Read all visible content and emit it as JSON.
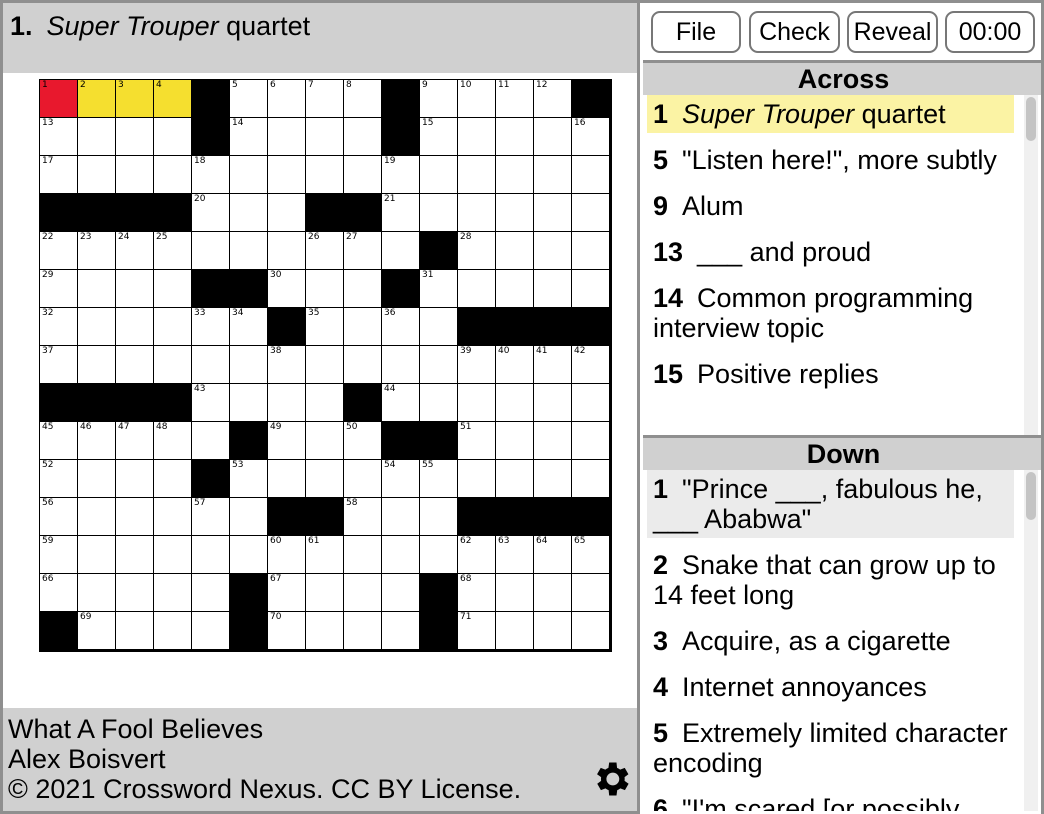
{
  "current_clue": {
    "number": "1.",
    "text_italic": "Super Trouper",
    "text_rest": " quartet"
  },
  "toolbar": {
    "file_label": "File",
    "check_label": "Check",
    "reveal_label": "Reveal",
    "timer": "00:00"
  },
  "across_title": "Across",
  "down_title": "Down",
  "across_clues": [
    {
      "num": "1",
      "italic": "Super Trouper",
      "text": " quartet"
    },
    {
      "num": "5",
      "italic": "",
      "text": "\"Listen here!\", more subtly"
    },
    {
      "num": "9",
      "italic": "",
      "text": "Alum"
    },
    {
      "num": "13",
      "italic": "",
      "text": "___ and proud"
    },
    {
      "num": "14",
      "italic": "",
      "text": "Common programming interview topic"
    },
    {
      "num": "15",
      "italic": "",
      "text": "Positive replies"
    }
  ],
  "down_clues": [
    {
      "num": "1",
      "text": "\"Prince ___, fabulous he, ___ Ababwa\""
    },
    {
      "num": "2",
      "text": "Snake that can grow up to 14 feet long"
    },
    {
      "num": "3",
      "text": "Acquire, as a cigarette"
    },
    {
      "num": "4",
      "text": "Internet annoyances"
    },
    {
      "num": "5",
      "text": "Extremely limited character encoding"
    },
    {
      "num": "6",
      "text": "\"I'm scared [or possibly"
    }
  ],
  "footer": {
    "title": "What A Fool Believes",
    "author": "Alex Boisvert",
    "copyright": "© 2021 Crossword Nexus. CC BY License."
  },
  "grid": {
    "rows": [
      "....#....#....#",
      "....#....#.....",
      "...............",
      "#####...##.....",
      "..........#....",
      "....##...#.....",
      "......#....####",
      "...............",
      "#####....#.....",
      "......#...##...",
      ".....#.........",
      ".....#..##...##",
      "...............",
      "......#....#...",
      "#.....#....#..."
    ],
    "rows_fixed": [
      "....#....#...#",
      "....#....#....",
      ".............."
    ],
    "numbers": [
      [
        0,
        0,
        "1"
      ],
      [
        0,
        1,
        "2"
      ],
      [
        0,
        2,
        "3"
      ],
      [
        0,
        3,
        "4"
      ],
      [
        0,
        5,
        "5"
      ],
      [
        0,
        6,
        "6"
      ],
      [
        0,
        7,
        "7"
      ],
      [
        0,
        8,
        "8"
      ],
      [
        0,
        10,
        "9"
      ],
      [
        0,
        11,
        "10"
      ],
      [
        0,
        12,
        "11"
      ],
      [
        0,
        13,
        "12"
      ],
      [
        1,
        0,
        "13"
      ],
      [
        1,
        5,
        "14"
      ],
      [
        1,
        10,
        "15"
      ],
      [
        1,
        14,
        "16"
      ],
      [
        2,
        0,
        "17"
      ],
      [
        2,
        4,
        "18"
      ],
      [
        2,
        9,
        "19"
      ],
      [
        3,
        4,
        "20"
      ],
      [
        3,
        9,
        "21"
      ],
      [
        4,
        0,
        "22"
      ],
      [
        4,
        1,
        "23"
      ],
      [
        4,
        2,
        "24"
      ],
      [
        4,
        3,
        "25"
      ],
      [
        4,
        7,
        "26"
      ],
      [
        4,
        8,
        "27"
      ],
      [
        4,
        11,
        "28"
      ],
      [
        5,
        0,
        "29"
      ],
      [
        5,
        6,
        "30"
      ],
      [
        5,
        10,
        "31"
      ],
      [
        6,
        0,
        "32"
      ],
      [
        6,
        4,
        "33"
      ],
      [
        6,
        5,
        "34"
      ],
      [
        6,
        7,
        "35"
      ],
      [
        6,
        9,
        "36"
      ],
      [
        7,
        0,
        "37"
      ],
      [
        7,
        6,
        "38"
      ],
      [
        7,
        11,
        "39"
      ],
      [
        7,
        12,
        "40"
      ],
      [
        7,
        13,
        "41"
      ],
      [
        7,
        14,
        "42"
      ],
      [
        8,
        4,
        "43"
      ],
      [
        8,
        9,
        "44"
      ],
      [
        9,
        0,
        "45"
      ],
      [
        9,
        1,
        "46"
      ],
      [
        9,
        2,
        "47"
      ],
      [
        9,
        3,
        "48"
      ],
      [
        9,
        6,
        "49"
      ],
      [
        9,
        8,
        "50"
      ],
      [
        9,
        11,
        "51"
      ],
      [
        10,
        0,
        "52"
      ],
      [
        10,
        5,
        "53"
      ],
      [
        10,
        9,
        "54"
      ],
      [
        10,
        10,
        "55"
      ],
      [
        11,
        0,
        "56"
      ],
      [
        11,
        4,
        "57"
      ],
      [
        11,
        8,
        "58"
      ],
      [
        12,
        0,
        "59"
      ],
      [
        12,
        6,
        "60"
      ],
      [
        12,
        7,
        "61"
      ],
      [
        12,
        11,
        "62"
      ],
      [
        12,
        12,
        "63"
      ],
      [
        12,
        13,
        "64"
      ],
      [
        12,
        14,
        "65"
      ],
      [
        13,
        0,
        "66"
      ],
      [
        13,
        6,
        "67"
      ],
      [
        13,
        11,
        "68"
      ],
      [
        14,
        1,
        "69"
      ],
      [
        14,
        6,
        "70"
      ],
      [
        14,
        11,
        "71"
      ]
    ],
    "current_cell": [
      0,
      0
    ],
    "selected_cells": [
      [
        0,
        1
      ],
      [
        0,
        2
      ],
      [
        0,
        3
      ]
    ],
    "colors": {
      "current": "#e8182d",
      "selected": "#f5df2f",
      "active_across_clue": "#fbf3a4"
    }
  }
}
